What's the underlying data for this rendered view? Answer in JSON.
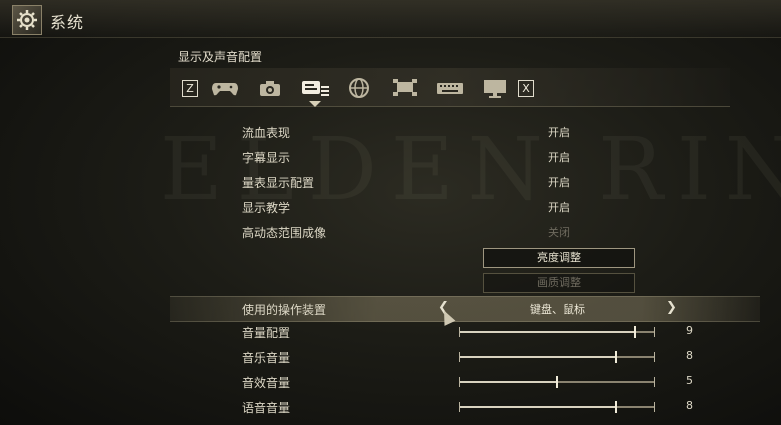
{
  "window": {
    "title": "系统"
  },
  "section": {
    "title": "显示及声音配置"
  },
  "tabs": {
    "left_key": "Z",
    "right_key": "X",
    "icons": [
      "gamepad-icon",
      "camera-icon",
      "display-settings-icon",
      "globe-icon",
      "network-icon",
      "keyboard-icon",
      "monitor-icon"
    ],
    "active_index": 2
  },
  "watermark": "ELDEN RING",
  "settings": [
    {
      "label": "流血表现",
      "value": "开启"
    },
    {
      "label": "字幕显示",
      "value": "开启"
    },
    {
      "label": "量表显示配置",
      "value": "开启"
    },
    {
      "label": "显示教学",
      "value": "开启"
    },
    {
      "label": "高动态范围成像",
      "value": "关闭",
      "disabled": true
    }
  ],
  "buttons": {
    "brightness": "亮度调整",
    "quality": "画质调整"
  },
  "device": {
    "label": "使用的操作装置",
    "value": "键盘、鼠标"
  },
  "volumes": [
    {
      "label": "音量配置",
      "value": "9",
      "level": 0.9
    },
    {
      "label": "音乐音量",
      "value": "8",
      "level": 0.8
    },
    {
      "label": "音效音量",
      "value": "5",
      "level": 0.5
    },
    {
      "label": "语音音量",
      "value": "8",
      "level": 0.8
    }
  ],
  "colors": {
    "accent": "#d8d2bf",
    "text": "#ddd8c6",
    "dim": "#6e6a5e"
  }
}
